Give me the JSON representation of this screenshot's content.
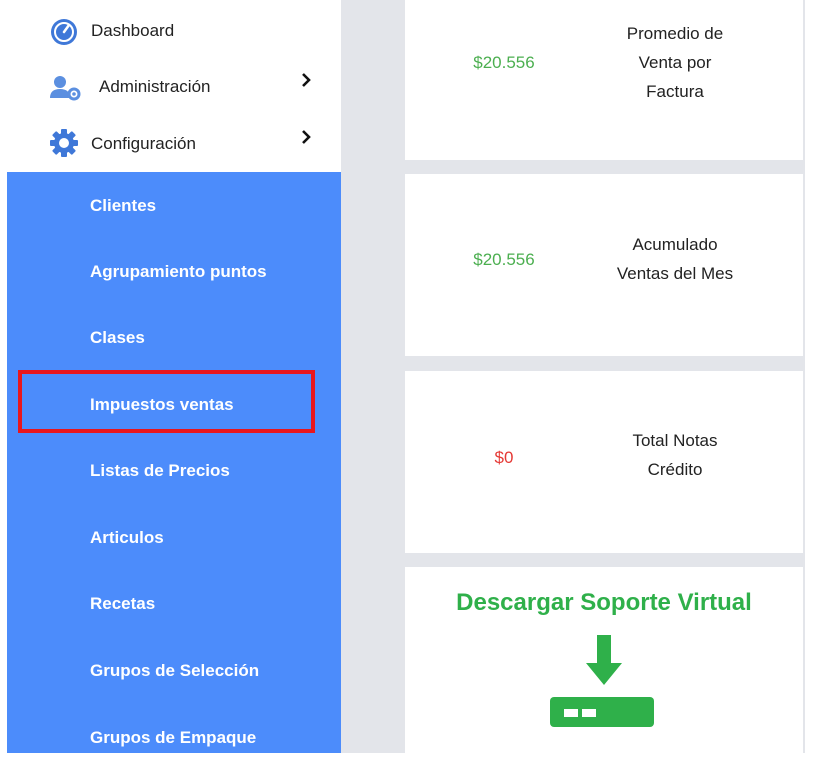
{
  "sidebar": {
    "top_items": [
      {
        "label": "Dashboard",
        "icon": "gauge-icon"
      },
      {
        "label": "Administración",
        "icon": "users-gear-icon"
      },
      {
        "label": "Configuración",
        "icon": "gear-icon"
      }
    ],
    "submenu": [
      {
        "label": "Clientes"
      },
      {
        "label": "Agrupamiento puntos"
      },
      {
        "label": "Clases"
      },
      {
        "label": "Impuestos ventas"
      },
      {
        "label": "Listas de Precios"
      },
      {
        "label": "Articulos"
      },
      {
        "label": "Recetas"
      },
      {
        "label": "Grupos de Selección"
      },
      {
        "label": "Grupos de Empaque"
      }
    ],
    "highlighted_item": "Impuestos ventas"
  },
  "cards": [
    {
      "value": "$20.556",
      "label_lines": [
        "Promedio de",
        "Venta por",
        "Factura"
      ],
      "value_color": "#4caf50"
    },
    {
      "value": "$20.556",
      "label_lines": [
        "Acumulado",
        "Ventas del Mes"
      ],
      "value_color": "#4caf50"
    },
    {
      "value": "$0",
      "label_lines": [
        "Total Notas",
        "Crédito"
      ],
      "value_color": "#e53935"
    }
  ],
  "download": {
    "title": "Descargar Soporte Virtual",
    "icon": "download-icon"
  },
  "colors": {
    "sidebar_accent": "#4c8cfb",
    "highlight_border": "#e8161d",
    "positive_value": "#4caf50",
    "negative_value": "#e53935",
    "download_green": "#2fb04a"
  }
}
